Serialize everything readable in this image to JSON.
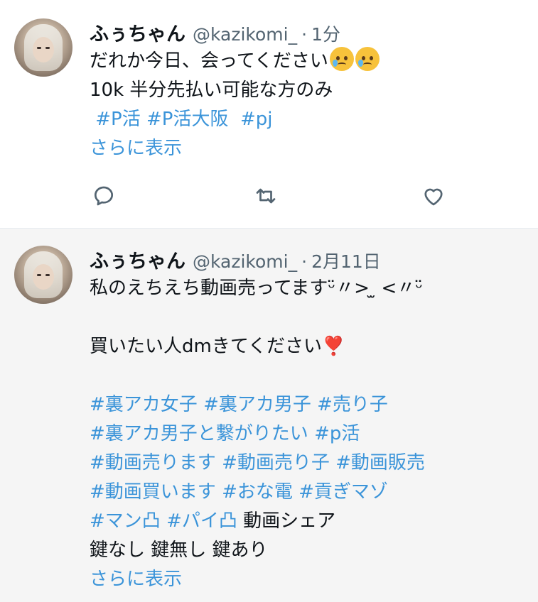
{
  "tweets": [
    {
      "name": "ふぅちゃん",
      "handle": "@kazikomi_",
      "separator": "·",
      "time": "1分",
      "text_line1": "だれか今日、会ってください",
      "emoji": [
        "crying-face",
        "crying-face"
      ],
      "text_line2": "10k  半分先払い可能な方のみ",
      "hashtags": [
        "#P活",
        "#P活大阪",
        "#pj"
      ],
      "show_more": "さらに表示",
      "actions": {
        "reply": "reply-icon",
        "retweet": "retweet-icon",
        "like": "heart-icon"
      }
    },
    {
      "name": "ふぅちゃん",
      "handle": "@kazikomi_",
      "separator": "·",
      "time": "2月11日",
      "text_line1": "私のえちえち動画売ってますᵕ̈〃> ̫ <〃ᵕ̈",
      "text_line2": "買いたい人dmきてください",
      "heart_emoji": "❣️",
      "hashtag_lines": [
        [
          "#裏アカ女子",
          "#裏アカ男子",
          "#売り子"
        ],
        [
          "#裏アカ男子と繋がりたい",
          "#p活"
        ],
        [
          "#動画売ります",
          "#動画売り子",
          "#動画販売"
        ],
        [
          "#動画買います",
          "#おな電",
          "#貢ぎマゾ"
        ],
        [
          "#マン凸",
          "#パイ凸"
        ]
      ],
      "line_tail": "動画シェア",
      "text_line3": "鍵なし 鍵無し 鍵あり",
      "show_more": "さらに表示"
    }
  ],
  "colors": {
    "link": "#3b94d9",
    "text": "#0f1419",
    "muted": "#536471",
    "second_bg": "#f5f5f5"
  }
}
